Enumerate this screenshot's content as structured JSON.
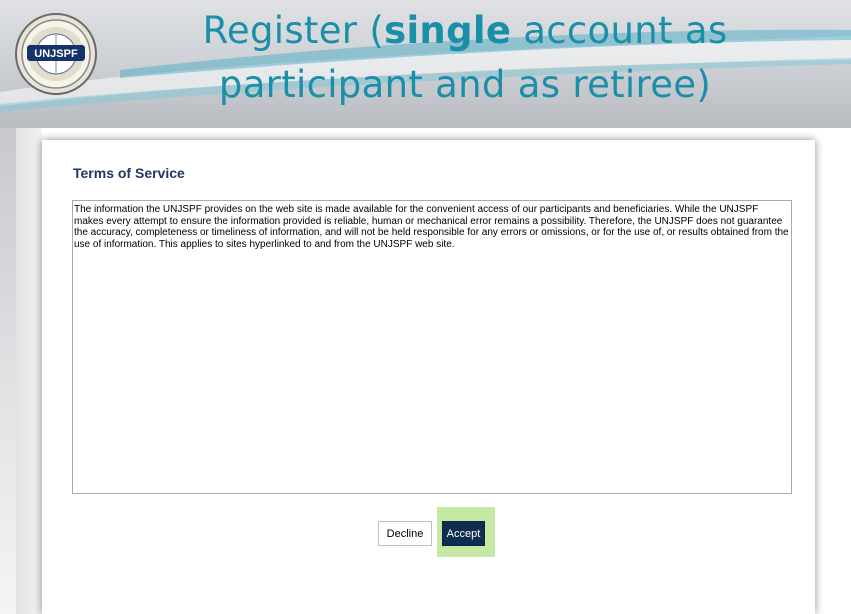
{
  "slide": {
    "title_line1_pre": "Register (",
    "title_line1_bold": "single",
    "title_line1_post": " account as",
    "title_line2": "participant and as retiree)",
    "logo_icon": "unjspf-seal-logo",
    "logo_text": "UNJSPF"
  },
  "terms": {
    "heading": "Terms of Service",
    "body": "The information the UNJSPF provides on the web site is made available for the convenient access of our participants and beneficiaries. While the UNJSPF makes every attempt to ensure the information provided is reliable, human or mechanical error remains a possibility. Therefore, the UNJSPF does not guarantee the accuracy, completeness or timeliness of information, and will not be held responsible for any errors or omissions, or for the use of, or results obtained from the use of information. This applies to sites hyperlinked to and from the UNJSPF web site."
  },
  "actions": {
    "decline_label": "Decline",
    "accept_label": "Accept"
  },
  "colors": {
    "title_teal": "#1c8fa8",
    "heading_navy": "#1f3864",
    "accept_bg": "#0f2e4f",
    "accept_highlight": "#c5e8a5"
  }
}
